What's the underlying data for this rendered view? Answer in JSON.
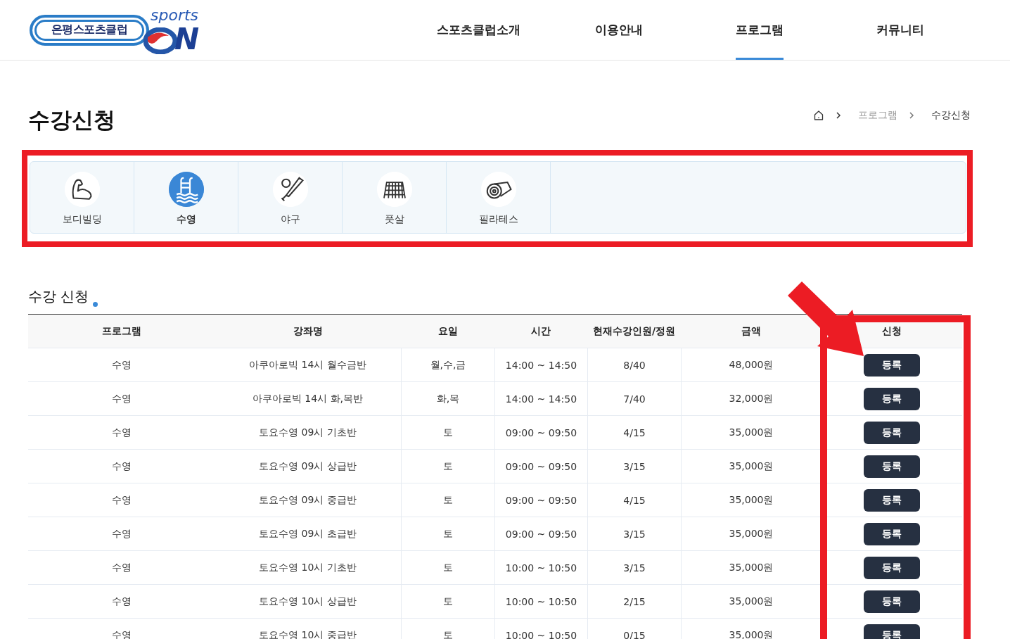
{
  "header": {
    "logo": {
      "name": "은평스포츠클럽",
      "tagline": "sports",
      "mark": "N"
    },
    "nav": [
      {
        "label": "스포츠클럽소개",
        "selected": false
      },
      {
        "label": "이용안내",
        "selected": false
      },
      {
        "label": "프로그램",
        "selected": true
      },
      {
        "label": "커뮤니티",
        "selected": false
      }
    ]
  },
  "page_title": "수강신청",
  "breadcrumb": [
    "프로그램",
    "수강신청"
  ],
  "categories": [
    {
      "kind": "bodybuilding",
      "label": "보디빌딩",
      "selected": false
    },
    {
      "kind": "swimming",
      "label": "수영",
      "selected": true
    },
    {
      "kind": "baseball",
      "label": "야구",
      "selected": false
    },
    {
      "kind": "futsal",
      "label": "풋살",
      "selected": false
    },
    {
      "kind": "pilates",
      "label": "필라테스",
      "selected": false
    }
  ],
  "section_title": "수강 신청",
  "table": {
    "columns": [
      "프로그램",
      "강좌명",
      "요일",
      "시간",
      "현재수강인원/정원",
      "금액",
      "신청"
    ],
    "rows": [
      {
        "program": "수영",
        "course": "아쿠아로빅 14시 월수금반",
        "days": "월,수,금",
        "time": "14:00 ~ 14:50",
        "enrollment": "8/40",
        "price": "48,000원",
        "action": "등록"
      },
      {
        "program": "수영",
        "course": "아쿠아로빅 14시 화,목반",
        "days": "화,목",
        "time": "14:00 ~ 14:50",
        "enrollment": "7/40",
        "price": "32,000원",
        "action": "등록"
      },
      {
        "program": "수영",
        "course": "토요수영 09시 기초반",
        "days": "토",
        "time": "09:00 ~ 09:50",
        "enrollment": "4/15",
        "price": "35,000원",
        "action": "등록"
      },
      {
        "program": "수영",
        "course": "토요수영 09시 상급반",
        "days": "토",
        "time": "09:00 ~ 09:50",
        "enrollment": "3/15",
        "price": "35,000원",
        "action": "등록"
      },
      {
        "program": "수영",
        "course": "토요수영 09시 중급반",
        "days": "토",
        "time": "09:00 ~ 09:50",
        "enrollment": "4/15",
        "price": "35,000원",
        "action": "등록"
      },
      {
        "program": "수영",
        "course": "토요수영 09시 초급반",
        "days": "토",
        "time": "09:00 ~ 09:50",
        "enrollment": "3/15",
        "price": "35,000원",
        "action": "등록"
      },
      {
        "program": "수영",
        "course": "토요수영 10시 기초반",
        "days": "토",
        "time": "10:00 ~ 10:50",
        "enrollment": "3/15",
        "price": "35,000원",
        "action": "등록"
      },
      {
        "program": "수영",
        "course": "토요수영 10시 상급반",
        "days": "토",
        "time": "10:00 ~ 10:50",
        "enrollment": "2/15",
        "price": "35,000원",
        "action": "등록"
      },
      {
        "program": "수영",
        "course": "토요수영 10시 중급반",
        "days": "토",
        "time": "10:00 ~ 10:50",
        "enrollment": "0/15",
        "price": "35,000원",
        "action": "등록"
      }
    ]
  },
  "annotations": [
    {
      "kind": "box"
    },
    {
      "kind": "box"
    },
    {
      "kind": "arrow"
    }
  ]
}
